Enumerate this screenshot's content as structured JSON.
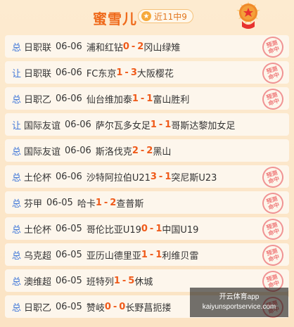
{
  "header": {
    "title": "蜜雪儿",
    "badge": "近11中9",
    "badge_icon": "star-icon",
    "medal_icon": "trophy-medal-icon"
  },
  "rows": [
    {
      "tag": "总",
      "league": "日职联",
      "date": "06-06",
      "home": "浦和红钻",
      "home_score": "0",
      "sep": "-",
      "away_score": "2",
      "away": "冈山绿雉",
      "stamp": true
    },
    {
      "tag": "让",
      "league": "日职联",
      "date": "06-06",
      "home": "FC东京",
      "home_score": "1",
      "sep": "-",
      "away_score": "3",
      "away": "大阪樱花",
      "stamp": true
    },
    {
      "tag": "总",
      "league": "日职乙",
      "date": "06-06",
      "home": "仙台维加泰",
      "home_score": "1",
      "sep": "-",
      "away_score": "1",
      "away": "富山胜利",
      "stamp": true
    },
    {
      "tag": "让",
      "league": "国际友谊",
      "date": "06-06",
      "home": "萨尔瓦多女足",
      "home_score": "1",
      "sep": "-",
      "away_score": "1",
      "away": "哥斯达黎加女足",
      "stamp": false
    },
    {
      "tag": "总",
      "league": "国际友谊",
      "date": "06-06",
      "home": "斯洛伐克",
      "home_score": "2",
      "sep": "-",
      "away_score": "2",
      "away": "黑山",
      "stamp": false
    },
    {
      "tag": "总",
      "league": "土伦杯",
      "date": "06-06",
      "home": "沙特阿拉伯U21",
      "home_score": "3",
      "sep": "-",
      "away_score": "1",
      "away": "突尼斯U23",
      "stamp": true
    },
    {
      "tag": "总",
      "league": "芬甲",
      "date": "06-05",
      "home": "哈卡",
      "home_score": "1",
      "sep": "-",
      "away_score": "2",
      "away": "查普斯",
      "stamp": true
    },
    {
      "tag": "总",
      "league": "土伦杯",
      "date": "06-05",
      "home": "哥伦比亚U19",
      "home_score": "0",
      "sep": "-",
      "away_score": "1",
      "away": "中国U19",
      "stamp": true
    },
    {
      "tag": "总",
      "league": "乌克超",
      "date": "06-05",
      "home": "亚历山德里亚",
      "home_score": "1",
      "sep": "-",
      "away_score": "1",
      "away": "利维贝雷",
      "stamp": true
    },
    {
      "tag": "总",
      "league": "澳维超",
      "date": "06-05",
      "home": "班特列",
      "home_score": "1",
      "sep": "-",
      "away_score": "5",
      "away": "休城",
      "stamp": true
    },
    {
      "tag": "总",
      "league": "日职乙",
      "date": "06-05",
      "home": "赞岐",
      "home_score": "0",
      "sep": "-",
      "away_score": "0",
      "away": "长野菖扼搂",
      "stamp": true
    }
  ],
  "stamp_text": {
    "line1": "预测",
    "line2": "命中"
  },
  "watermark": {
    "line1": "开云体育app",
    "line2": "kaiyunsportservice.com"
  }
}
